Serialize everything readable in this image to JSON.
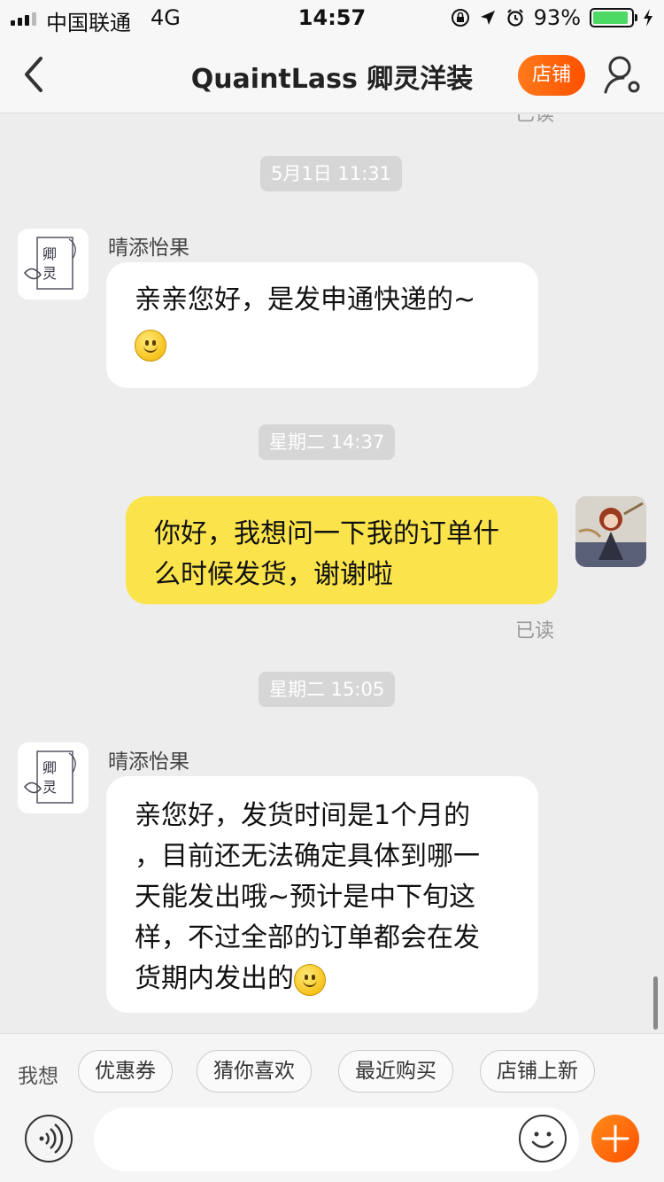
{
  "status_bar": {
    "carrier": "中国联通",
    "network": "4G",
    "time": "14:57",
    "battery": "93%",
    "battery_level": 0.93,
    "icons": [
      "orientation-lock-icon",
      "location-icon",
      "alarm-icon",
      "charging-icon"
    ]
  },
  "nav": {
    "title": "QuaintLass 卿灵洋装",
    "store_button": "店铺",
    "back_icon": "back-chevron-icon",
    "profile_icon": "user-settings-icon"
  },
  "chat": {
    "read_label": "已读",
    "messages": [
      {
        "type": "time",
        "text": "5月1日 11:31"
      },
      {
        "type": "incoming",
        "sender": "晴添怡果",
        "text": "亲亲您好，是发申通快递的~",
        "emoji": "smile-emoji"
      },
      {
        "type": "time",
        "text": "星期二 14:37"
      },
      {
        "type": "outgoing",
        "text": "你好，我想问一下我的订单什么时候发货，谢谢啦",
        "line1": "你好，我想问一下我的订单什",
        "line2": "么时候发货，谢谢啦",
        "status": "已读"
      },
      {
        "type": "time",
        "text": "星期二 15:05"
      },
      {
        "type": "incoming",
        "sender": "晴添怡果",
        "line1": "亲您好，发货时间是1个月的",
        "line2": "，目前还无法确定具体到哪一",
        "line3": "天能发出哦~预计是中下旬这",
        "line4": "样，不过全部的订单都会在发",
        "line5": "货期内发出的",
        "emoji": "smile-emoji"
      }
    ]
  },
  "quick_replies": {
    "label": "我想",
    "chips": [
      "优惠券",
      "猜你喜欢",
      "最近购买",
      "店铺上新"
    ]
  },
  "input_bar": {
    "placeholder": "",
    "voice_icon": "voice-icon",
    "emoji_icon": "emoji-icon",
    "add_icon": "plus-icon"
  },
  "colors": {
    "accent": "#ff5000",
    "outgoing_bubble": "#fbe44b",
    "incoming_bubble": "#ffffff",
    "background": "#ededed"
  }
}
